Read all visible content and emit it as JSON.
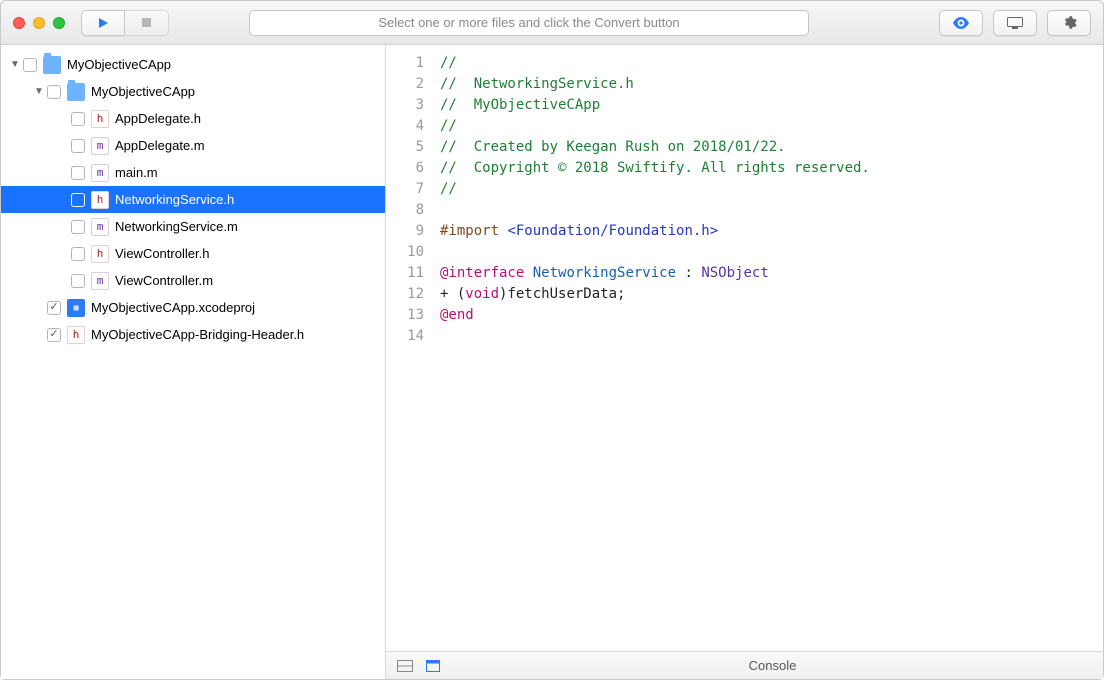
{
  "toolbar": {
    "hint": "Select one or more files and click the Convert button"
  },
  "sidebar": {
    "items": [
      {
        "depth": 0,
        "disclosure": "▼",
        "checked": false,
        "icon": "folder",
        "label": "MyObjectiveCApp"
      },
      {
        "depth": 1,
        "disclosure": "▼",
        "checked": false,
        "icon": "folder",
        "label": "MyObjectiveCApp"
      },
      {
        "depth": 2,
        "disclosure": "",
        "checked": false,
        "icon": "h",
        "label": "AppDelegate.h"
      },
      {
        "depth": 2,
        "disclosure": "",
        "checked": false,
        "icon": "m",
        "label": "AppDelegate.m"
      },
      {
        "depth": 2,
        "disclosure": "",
        "checked": false,
        "icon": "m",
        "label": "main.m"
      },
      {
        "depth": 2,
        "disclosure": "",
        "checked": false,
        "icon": "h",
        "label": "NetworkingService.h",
        "selected": true
      },
      {
        "depth": 2,
        "disclosure": "",
        "checked": false,
        "icon": "m",
        "label": "NetworkingService.m"
      },
      {
        "depth": 2,
        "disclosure": "",
        "checked": false,
        "icon": "h",
        "label": "ViewController.h"
      },
      {
        "depth": 2,
        "disclosure": "",
        "checked": false,
        "icon": "m",
        "label": "ViewController.m"
      },
      {
        "depth": 1,
        "disclosure": "",
        "checked": true,
        "icon": "proj",
        "label": "MyObjectiveCApp.xcodeproj"
      },
      {
        "depth": 1,
        "disclosure": "",
        "checked": true,
        "icon": "h",
        "label": "MyObjectiveCApp-Bridging-Header.h"
      }
    ]
  },
  "editor": {
    "lines": [
      {
        "n": 1,
        "html": "<span class='c-comment'>//</span>"
      },
      {
        "n": 2,
        "html": "<span class='c-comment'>//  NetworkingService.h</span>"
      },
      {
        "n": 3,
        "html": "<span class='c-comment'>//  MyObjectiveCApp</span>"
      },
      {
        "n": 4,
        "html": "<span class='c-comment'>//</span>"
      },
      {
        "n": 5,
        "html": "<span class='c-comment'>//  Created by Keegan Rush on 2018/01/22.</span>"
      },
      {
        "n": 6,
        "html": "<span class='c-comment'>//  Copyright © 2018 Swiftify. All rights reserved.</span>"
      },
      {
        "n": 7,
        "html": "<span class='c-comment'>//</span>"
      },
      {
        "n": 8,
        "html": ""
      },
      {
        "n": 9,
        "html": "<span class='c-pp'>#import </span><span class='c-ppval'>&lt;Foundation/Foundation.h&gt;</span>"
      },
      {
        "n": 10,
        "html": ""
      },
      {
        "n": 11,
        "html": "<span class='c-kw'>@interface</span> <span class='c-type'>NetworkingService</span> : <span class='c-ref'>NSObject</span>"
      },
      {
        "n": 12,
        "html": "+ (<span class='c-kw'>void</span>)fetchUserData;"
      },
      {
        "n": 13,
        "html": "<span class='c-kw'>@end</span>"
      },
      {
        "n": 14,
        "html": ""
      }
    ]
  },
  "console": {
    "label": "Console"
  }
}
